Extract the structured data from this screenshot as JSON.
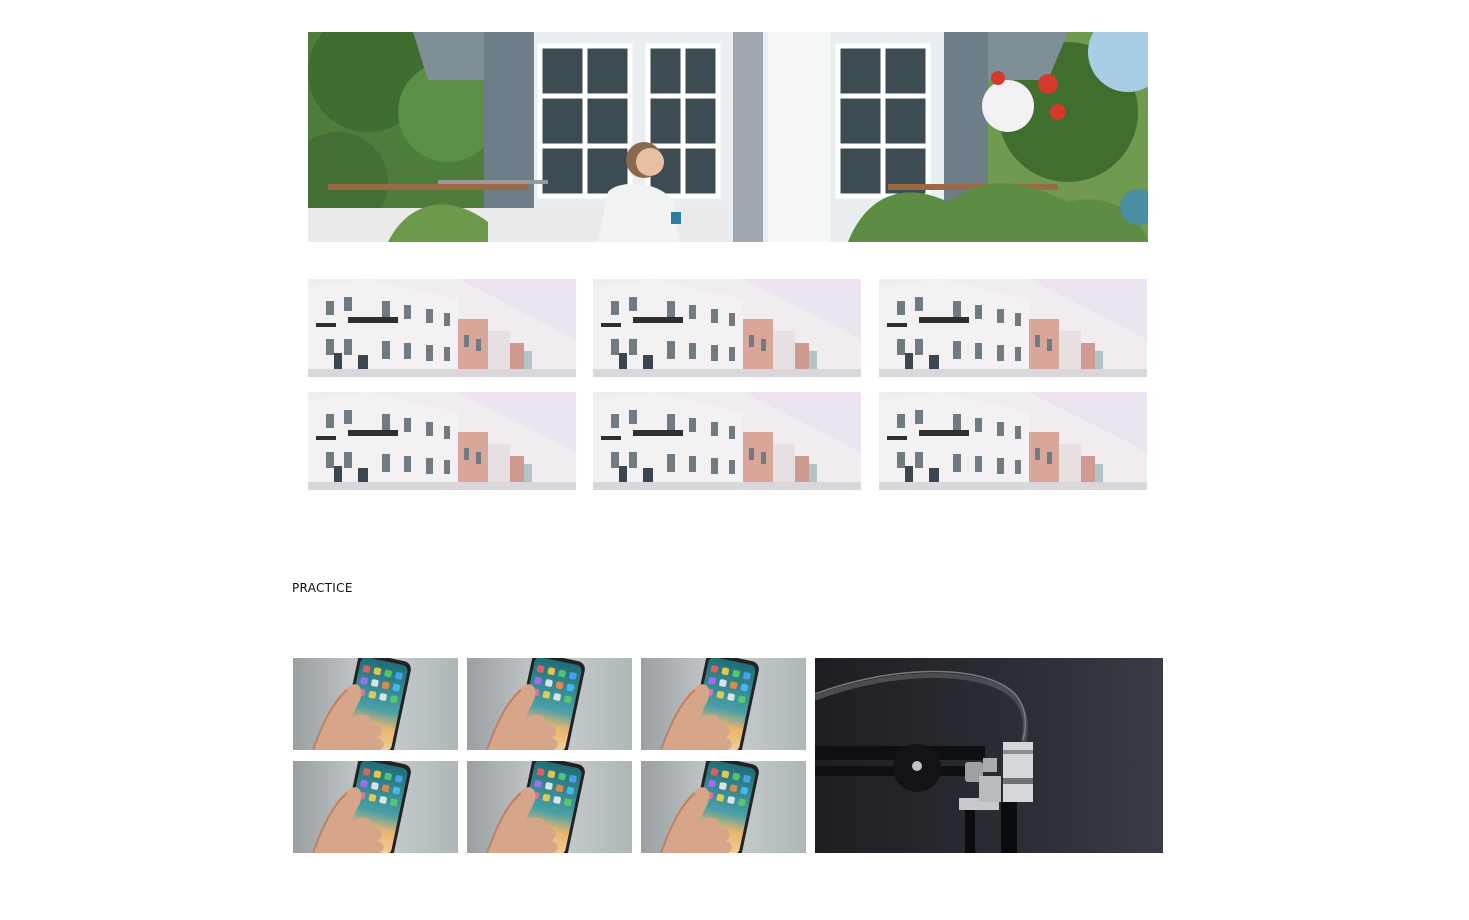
{
  "section": {
    "label": "PRACTICE"
  },
  "images": {
    "hero": "garden-house-photo",
    "grid_top": [
      "building-photo",
      "building-photo",
      "building-photo",
      "building-photo",
      "building-photo",
      "building-photo"
    ],
    "grid_bottom": [
      "smartphone-photo",
      "smartphone-photo",
      "smartphone-photo",
      "smartphone-photo",
      "smartphone-photo",
      "smartphone-photo"
    ],
    "feature": "microphone-photo"
  }
}
